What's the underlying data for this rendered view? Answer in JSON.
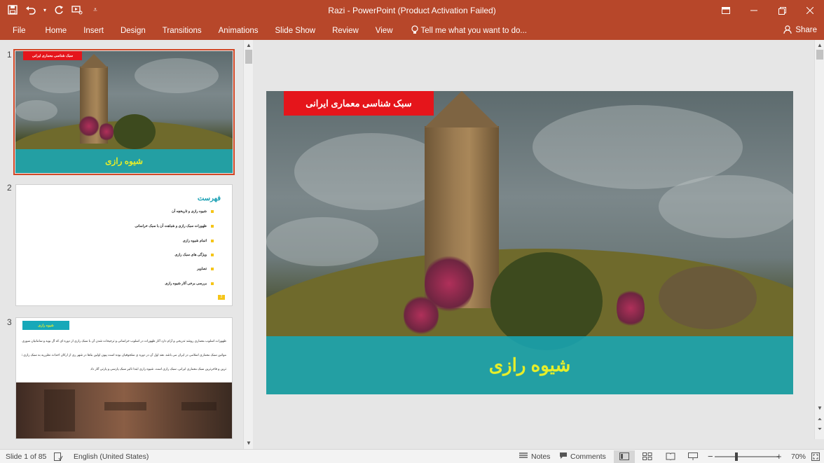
{
  "window": {
    "title": "Razi - PowerPoint (Product Activation Failed)",
    "icons": {
      "save": "save-icon",
      "undo": "undo-icon",
      "redo": "redo-icon",
      "present": "start-from-beginning-icon",
      "customize": "customize-qat-icon",
      "ribbon_display": "ribbon-display-options-icon",
      "minimize": "minimize-icon",
      "maximize": "maximize-icon",
      "close": "close-icon"
    }
  },
  "ribbon": {
    "tabs": [
      "File",
      "Home",
      "Insert",
      "Design",
      "Transitions",
      "Animations",
      "Slide Show",
      "Review",
      "View"
    ],
    "tell_me": "Tell me what you want to do...",
    "share": "Share"
  },
  "slides": [
    {
      "number": "1",
      "red_label": "سبک شناسی معماری ایرانی",
      "title": "شیوه رازی"
    },
    {
      "number": "2",
      "heading": "فهرست",
      "items": [
        "شیوه رازی و تاریخچه آن",
        "ظهورات سبک رازی و شباهت آن با سبک خراسانی",
        "اتمام شیوه رازی",
        "ویژگی های سبک رازی",
        "تصاویر",
        "بررسی برخی آثار شیوه رازی"
      ],
      "badge": "2"
    },
    {
      "number": "3",
      "label": "شیوه رازی",
      "lines": [
        "ظهورات اسلوب معماری روشد تدریجی و آرام دارد آثار ظهورات در اسلوب خراسانی و ترجیحات شدن آن با سبک رازی از دوره ای که آل بویه و سامانیان سوری طرفه اسان شیوه رازی",
        "مواتین سبک معماری اسلامی در ایران می باشد. هند اول آن در دوره ی سلجوقیان بوده است پیون اولین بناها در شهر ری از ارکان احداث نظرریه به سبک رازی تحقیقات است. اصلی",
        "ترین و فاخرترین سبک معماری ایرانی. سبک رازی است. شیوه رازی ابتدا تأثیر سبک پارسی و پارتی آثار داد"
      ]
    }
  ],
  "main_slide": {
    "red_label": "سبک شناسی معماری ایرانی",
    "title": "شیوه رازی"
  },
  "status": {
    "slide_of": "Slide 1 of 85",
    "language": "English (United States)",
    "notes": "Notes",
    "comments": "Comments",
    "zoom_percent": "70%",
    "zoom_value": 0.7
  },
  "colors": {
    "accent": "#b7472a",
    "teal": "#16a8b9",
    "title_yellow": "#e6ee2a",
    "label_red": "#e5151b"
  }
}
